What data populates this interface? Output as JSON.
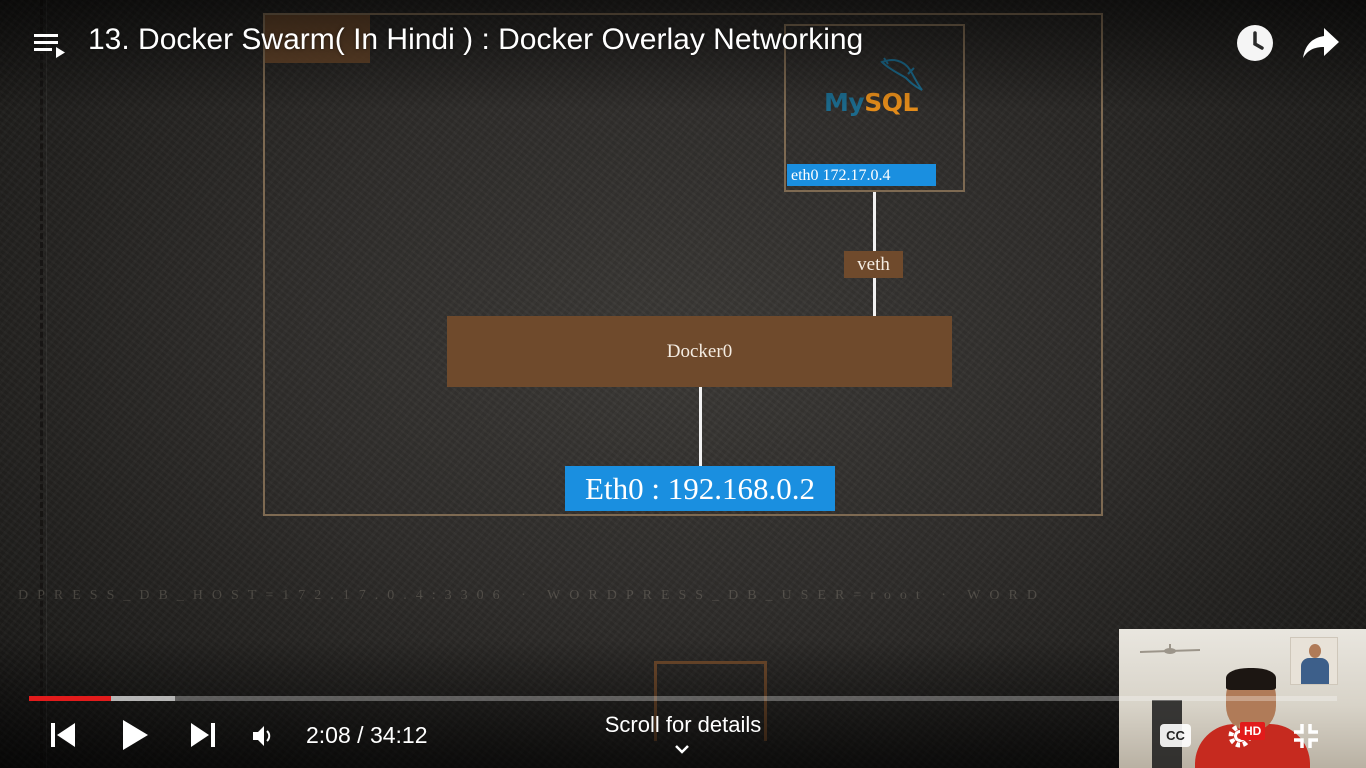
{
  "player": {
    "title": "13. Docker Swarm( In Hindi ) : Docker Overlay Networking",
    "time_current": "2:08",
    "time_separator": " / ",
    "time_total": "34:12",
    "progress_played": 0.063,
    "progress_buffered": 0.112,
    "scroll_hint": "Scroll for details",
    "cc_label": "CC",
    "hd_badge": "HD",
    "accent_color": "#e21b1b",
    "icons": [
      "playlist-icon",
      "watch-later-icon",
      "share-icon",
      "previous-icon",
      "play-icon",
      "next-icon",
      "volume-icon",
      "chevron-down-icon",
      "captions-icon",
      "settings-icon",
      "exit-fullscreen-icon"
    ]
  },
  "slide": {
    "mysql_logo_my": "My",
    "mysql_logo_sql": "SQL",
    "container_eth": "eth0 172.17.0.4",
    "veth_label": "veth",
    "bridge_label": "Docker0",
    "host_eth": "Eth0 : 192.168.0.2",
    "watermark": "DPRESS_DB_HOST=172.17.0.4:3306 · WORDPRESS_DB_USER=root · WORD",
    "colors": {
      "box_brown": "#6f4a2c",
      "highlight_blue": "#1a8fe0",
      "frame_border": "#7e6a52"
    }
  }
}
